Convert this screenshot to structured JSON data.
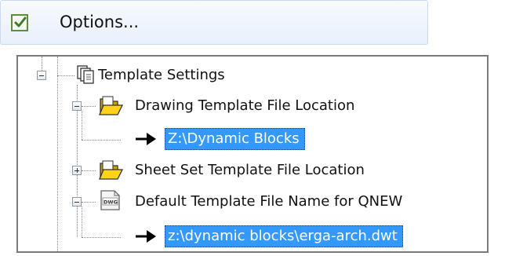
{
  "menu": {
    "options_label": "Options...",
    "icon": "checkbox-checked-icon"
  },
  "tree": {
    "template_settings": {
      "label": "Template Settings",
      "icon": "settings-pages-icon"
    },
    "drawing_template": {
      "label": "Drawing Template File Location",
      "icon": "folder-open-icon"
    },
    "drawing_template_value": {
      "label": "Z:\\Dynamic Blocks",
      "icon": "arrow-right-icon"
    },
    "sheet_set_template": {
      "label": "Sheet Set Template File Location",
      "icon": "folder-open-icon"
    },
    "default_template": {
      "label": "Default Template File Name for QNEW",
      "icon": "dwg-file-icon"
    },
    "default_template_value": {
      "label": "z:\\dynamic blocks\\erga-arch.dwt",
      "icon": "arrow-right-icon"
    }
  },
  "colors": {
    "selection": "#3399ff",
    "selection_text": "#ffffff",
    "menu_bg": "#eef4fc",
    "check_green": "#5b8f3a"
  }
}
